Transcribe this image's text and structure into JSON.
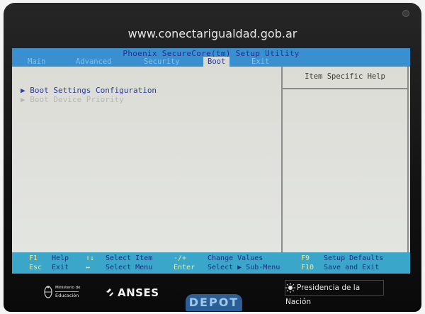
{
  "bezel": {
    "url": "www.conectarigualdad.gob.ar"
  },
  "bios": {
    "title": "Phoenix SecureCore(tm) Setup Utility",
    "tabs": [
      {
        "label": "Main"
      },
      {
        "label": "Advanced"
      },
      {
        "label": "Security"
      },
      {
        "label": "Boot",
        "active": true
      },
      {
        "label": "Exit"
      }
    ],
    "menu": [
      {
        "arrow": "▶",
        "label": "Boot Settings Configuration"
      },
      {
        "arrow": "▶",
        "label": "Boot Device Priority"
      }
    ],
    "help_title": "Item Specific Help",
    "footer": {
      "f1_key": "F1",
      "f1_desc": "Help",
      "esc_key": "Esc",
      "esc_desc": "Exit",
      "updown_key": "↑↓",
      "updown_desc": "Select Item",
      "leftright_key": "↔",
      "leftright_desc": "Select Menu",
      "plusminus_key": "-/+",
      "plusminus_desc": "Change Values",
      "enter_key": "Enter",
      "enter_desc": "Select ▶ Sub-Menu",
      "f9_key": "F9",
      "f9_desc": "Setup Defaults",
      "f10_key": "F10",
      "f10_desc": "Save and Exit"
    }
  },
  "brands": {
    "ministerio_line1": "Ministerio de",
    "ministerio_line2": "Educación",
    "anses": "ANSES",
    "depot": "DEPOT",
    "presidencia": "Presidencia de la Nación"
  },
  "colors": {
    "title_bar": "#3a8fd0",
    "footer_bar": "#3aa6c9",
    "screen_bg": "#dcdcd6",
    "menu_text": "#2b3aa8",
    "key_text": "#f1e98a"
  }
}
